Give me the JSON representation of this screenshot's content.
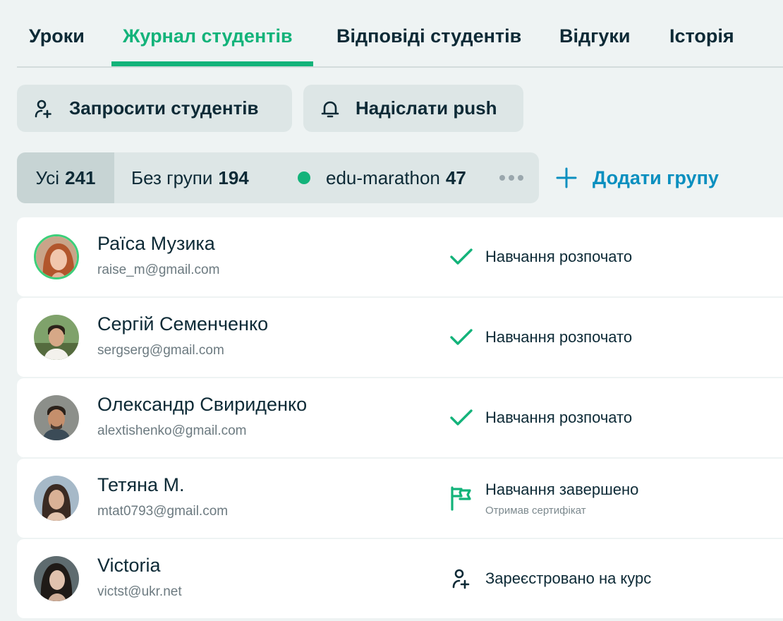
{
  "tabs": [
    {
      "label": "Уроки"
    },
    {
      "label": "Журнал студентів",
      "active": true
    },
    {
      "label": "Відповіді студентів"
    },
    {
      "label": "Відгуки"
    },
    {
      "label": "Історія"
    }
  ],
  "actions": {
    "invite_label": "Запросити студентів",
    "push_label": "Надіслати push"
  },
  "groups": {
    "all": {
      "label": "Усі",
      "count": "241"
    },
    "no_group": {
      "label": "Без групи",
      "count": "194"
    },
    "custom": {
      "label": "edu-marathon",
      "count": "47",
      "color": "#13b37a"
    },
    "add_label": "Додати групу"
  },
  "students": [
    {
      "name": "Раїса Музика",
      "email": "raise_m@gmail.com",
      "status": "Навчання розпочато",
      "status_sub": "",
      "status_icon": "check-icon"
    },
    {
      "name": "Сергій Семенченко",
      "email": "sergserg@gmail.com",
      "status": "Навчання розпочато",
      "status_sub": "",
      "status_icon": "check-icon"
    },
    {
      "name": "Олександр Свириденко",
      "email": "alextishenko@gmail.com",
      "status": "Навчання розпочато",
      "status_sub": "",
      "status_icon": "check-icon"
    },
    {
      "name": "Тетяна М.",
      "email": "mtat0793@gmail.com",
      "status": "Навчання завершено",
      "status_sub": "Отримав сертифікат",
      "status_icon": "flag-icon"
    },
    {
      "name": "Victoria",
      "email": "victst@ukr.net",
      "status": "Зареєстровано на курс",
      "status_sub": "",
      "status_icon": "user-add-icon"
    }
  ],
  "colors": {
    "accent": "#13b37a",
    "link": "#0a8fbf",
    "text": "#0d2a36"
  }
}
